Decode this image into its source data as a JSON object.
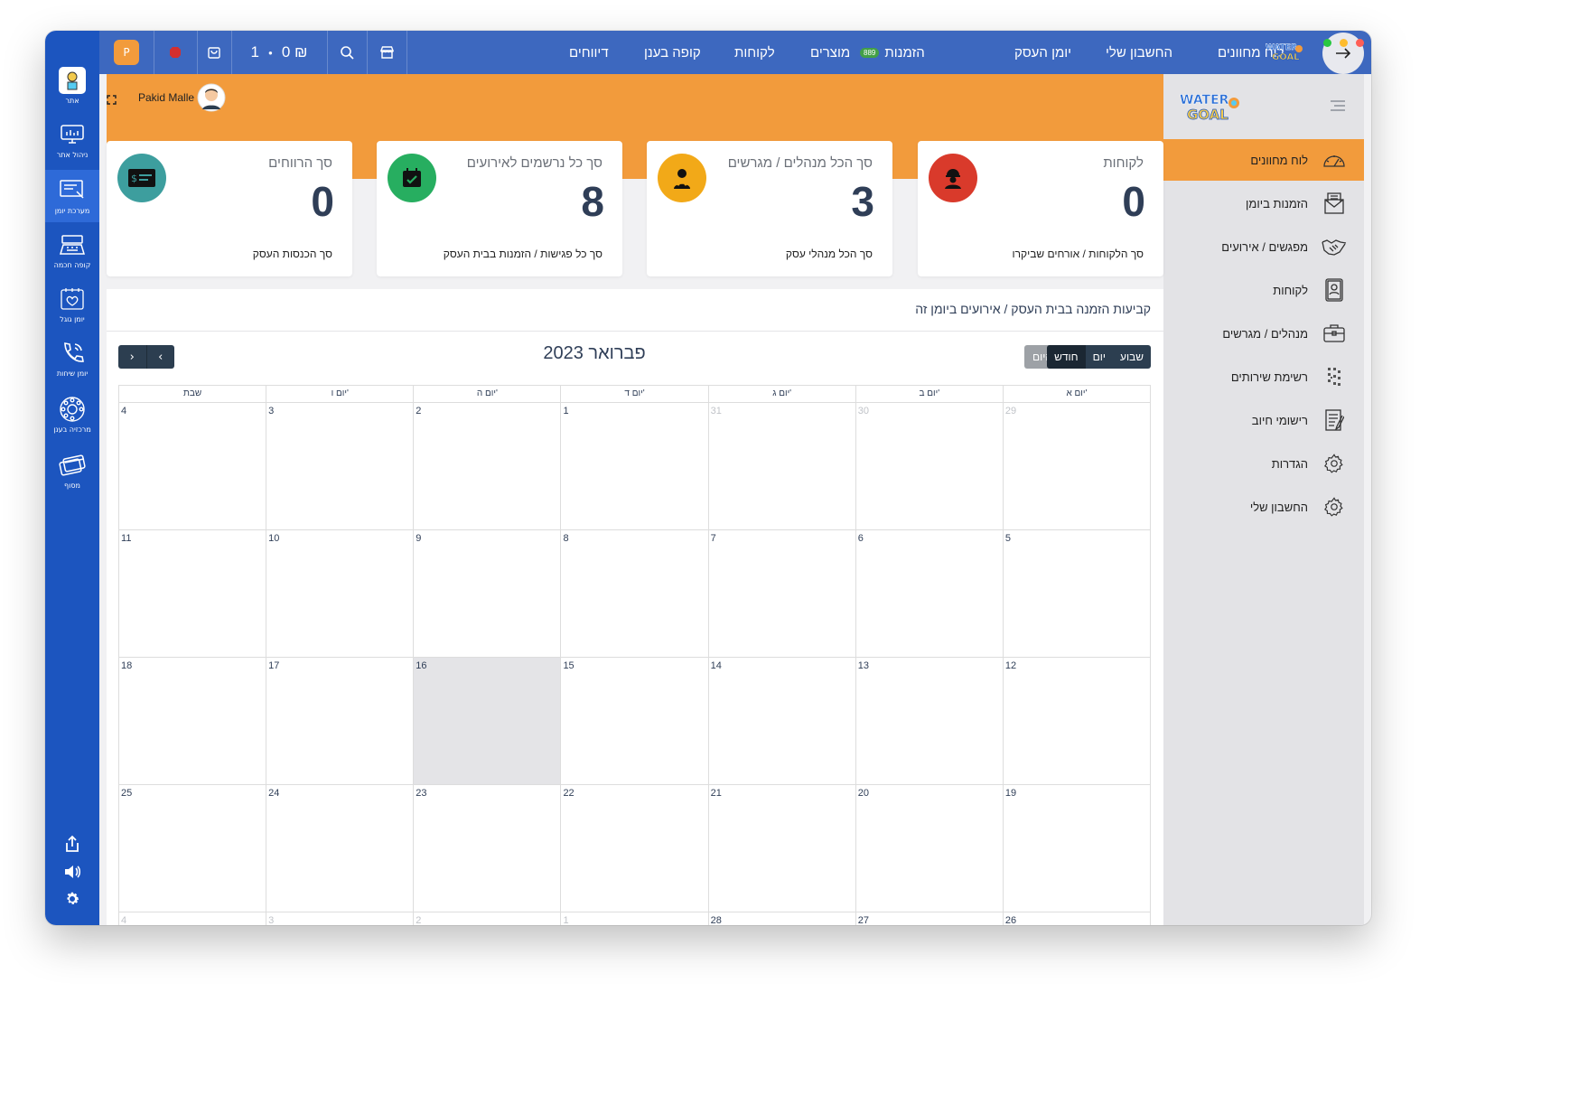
{
  "topbar": {
    "menu": [
      "לוח מחוונים",
      "החשבון שלי",
      "יומן העסק",
      "הזמנות",
      "מוצרים",
      "לקוחות",
      "קופה בענן",
      "דיווחים"
    ],
    "orders_badge": "889",
    "currency_amount": "0 ₪",
    "cart_count": "1",
    "profile_initial": "P",
    "logo_text": "WATER GOAL"
  },
  "rail": {
    "items": [
      "אתר",
      "ניהול אתר",
      "מערכת יומן",
      "קופה חכמה",
      "יומן גוגל",
      "יומן שיחות",
      "מרכזיה בענן",
      "מסוף"
    ]
  },
  "user": {
    "name": "Pakid Malle"
  },
  "right_nav": {
    "items": [
      "לוח מחוונים",
      "הזמנות ביומן",
      "מפגשים / אירועים",
      "לקוחות",
      "מנהלים / מגרשים",
      "רשימת שירותים",
      "רישומי חיוב",
      "הגדרות",
      "החשבון שלי"
    ]
  },
  "cards": [
    {
      "title": "לקוחות",
      "value": "0",
      "sub": "סך הלקוחות / אורחים שביקרו",
      "color": "#d93a2b"
    },
    {
      "title": "סך הכל מנהלים / מגרשים",
      "value": "3",
      "sub": "סך הכל מנהלי עסק",
      "color": "#f2a918"
    },
    {
      "title": "סך כל נרשמים לאירועים",
      "value": "8",
      "sub": "סך כל פגישות / הזמנות בבית העסק",
      "color": "#27ae60"
    },
    {
      "title": "סך הרווחים",
      "value": "0",
      "sub": "סך הכנסות העסק",
      "color": "#3d9e9e"
    }
  ],
  "calendar": {
    "panel_title": "קביעות הזמנה בבית העסק / אירועים ביומן זה",
    "month_title": "פברואר 2023",
    "view_buttons": [
      "שבוע",
      "יום",
      "חודש"
    ],
    "active_view": "חודש",
    "today_label": "היום",
    "prev_label": "‹",
    "next_label": "›",
    "weekdays": [
      "יום א'",
      "יום ב'",
      "יום ג'",
      "יום ד'",
      "יום ה'",
      "יום ו'",
      "שבת"
    ],
    "today_date": "16",
    "weeks": [
      [
        {
          "d": "29",
          "o": true
        },
        {
          "d": "30",
          "o": true
        },
        {
          "d": "31",
          "o": true
        },
        {
          "d": "1"
        },
        {
          "d": "2"
        },
        {
          "d": "3"
        },
        {
          "d": "4"
        }
      ],
      [
        {
          "d": "5"
        },
        {
          "d": "6"
        },
        {
          "d": "7"
        },
        {
          "d": "8"
        },
        {
          "d": "9"
        },
        {
          "d": "10"
        },
        {
          "d": "11"
        }
      ],
      [
        {
          "d": "12"
        },
        {
          "d": "13"
        },
        {
          "d": "14"
        },
        {
          "d": "15"
        },
        {
          "d": "16",
          "t": true
        },
        {
          "d": "17"
        },
        {
          "d": "18"
        }
      ],
      [
        {
          "d": "19"
        },
        {
          "d": "20"
        },
        {
          "d": "21"
        },
        {
          "d": "22"
        },
        {
          "d": "23"
        },
        {
          "d": "24"
        },
        {
          "d": "25"
        }
      ],
      [
        {
          "d": "26"
        },
        {
          "d": "27"
        },
        {
          "d": "28"
        },
        {
          "d": "1",
          "o": true
        },
        {
          "d": "2",
          "o": true
        },
        {
          "d": "3",
          "o": true
        },
        {
          "d": "4",
          "o": true
        }
      ]
    ]
  },
  "colors": {
    "rail": "#1c55bf",
    "topbar": "#3d68bf",
    "accent": "#f29b3c"
  }
}
